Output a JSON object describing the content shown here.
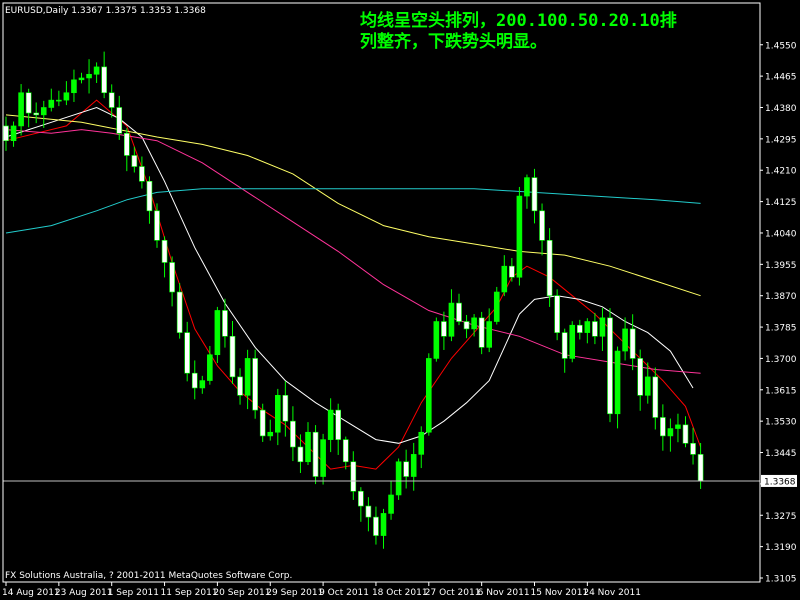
{
  "header": {
    "symbol_info": "EURUSD,Daily  1.3367 1.3375 1.3353 1.3368"
  },
  "annotation": {
    "line1": "均线呈空头排列，200.100.50.20.10排",
    "line2": "列整齐，下跌势头明显。"
  },
  "footer": {
    "copyright": "FX Solutions Australia, ? 2001-2011 MetaQuotes Software Corp."
  },
  "colors": {
    "background": "#000000",
    "frame": "#ffffff",
    "grid": "#c0c0c0",
    "bull": "#00ff00",
    "bear": "#ffffff",
    "current_price_line": "#c0c0c0",
    "annotation": "#00ff00",
    "ma10": "#ff0000",
    "ma20": "#ffffff",
    "ma50": "#ff3399",
    "ma100": "#ffff66",
    "ma200": "#22cccc"
  },
  "chart_data": {
    "type": "candlestick",
    "symbol": "EURUSD",
    "timeframe": "Daily",
    "current_price": 1.3368,
    "ylim": [
      1.3105,
      1.459
    ],
    "y_ticks": [
      1.455,
      1.4465,
      1.438,
      1.4295,
      1.421,
      1.4125,
      1.404,
      1.3955,
      1.387,
      1.3785,
      1.37,
      1.3615,
      1.353,
      1.3445,
      1.336,
      1.3275,
      1.319,
      1.3105
    ],
    "y_tick_labels": [
      "1.4550",
      "1.4465",
      "1.4380",
      "1.4295",
      "1.4210",
      "1.4125",
      "1.4040",
      "1.3955",
      "1.3870",
      "1.3785",
      "1.3700",
      "1.3615",
      "1.3530",
      "1.3445",
      "1.3368",
      "1.3275",
      "1.3190",
      "1.3105"
    ],
    "x_labels": [
      {
        "label": "14 Aug 2011",
        "bar": 0
      },
      {
        "label": "23 Aug 2011",
        "bar": 7
      },
      {
        "label": "1 Sep 2011",
        "bar": 14
      },
      {
        "label": "11 Sep 2011",
        "bar": 21
      },
      {
        "label": "20 Sep 2011",
        "bar": 28
      },
      {
        "label": "29 Sep 2011",
        "bar": 35
      },
      {
        "label": "9 Oct 2011",
        "bar": 42
      },
      {
        "label": "18 Oct 2011",
        "bar": 49
      },
      {
        "label": "27 Oct 2011",
        "bar": 56
      },
      {
        "label": "6 Nov 2011",
        "bar": 63
      },
      {
        "label": "15 Nov 2011",
        "bar": 70
      },
      {
        "label": "24 Nov 2011",
        "bar": 77
      }
    ],
    "close": [
      1.429,
      1.433,
      1.442,
      1.4365,
      1.436,
      1.438,
      1.44,
      1.44,
      1.442,
      1.4455,
      1.446,
      1.447,
      1.449,
      1.442,
      1.438,
      1.431,
      1.425,
      1.422,
      1.418,
      1.41,
      1.402,
      1.396,
      1.388,
      1.377,
      1.366,
      1.362,
      1.364,
      1.371,
      1.383,
      1.376,
      1.365,
      1.36,
      1.37,
      1.356,
      1.349,
      1.35,
      1.36,
      1.353,
      1.346,
      1.342,
      1.35,
      1.338,
      1.348,
      1.356,
      1.348,
      1.342,
      1.334,
      1.33,
      1.327,
      1.322,
      1.328,
      1.333,
      1.342,
      1.338,
      1.344,
      1.35,
      1.37,
      1.38,
      1.376,
      1.385,
      1.38,
      1.378,
      1.381,
      1.373,
      1.38,
      1.388,
      1.395,
      1.392,
      1.414,
      1.419,
      1.41,
      1.402,
      1.387,
      1.377,
      1.37,
      1.379,
      1.377,
      1.38,
      1.376,
      1.381,
      1.355,
      1.372,
      1.378,
      1.37,
      1.36,
      1.365,
      1.354,
      1.349,
      1.351,
      1.352,
      1.347,
      1.344,
      1.3368
    ],
    "series": [
      {
        "name": "MA10",
        "color": "#ff0000",
        "points": [
          [
            0,
            1.429
          ],
          [
            8,
            1.433
          ],
          [
            12,
            1.44
          ],
          [
            16,
            1.433
          ],
          [
            19,
            1.416
          ],
          [
            22,
            1.396
          ],
          [
            25,
            1.378
          ],
          [
            28,
            1.368
          ],
          [
            31,
            1.361
          ],
          [
            34,
            1.356
          ],
          [
            37,
            1.352
          ],
          [
            40,
            1.346
          ],
          [
            43,
            1.34
          ],
          [
            46,
            1.341
          ],
          [
            49,
            1.34
          ],
          [
            52,
            1.346
          ],
          [
            55,
            1.358
          ],
          [
            57,
            1.364
          ],
          [
            59,
            1.37
          ],
          [
            62,
            1.377
          ],
          [
            65,
            1.384
          ],
          [
            67,
            1.392
          ],
          [
            69,
            1.395
          ],
          [
            72,
            1.392
          ],
          [
            75,
            1.387
          ],
          [
            78,
            1.382
          ],
          [
            81,
            1.376
          ],
          [
            84,
            1.37
          ],
          [
            87,
            1.364
          ],
          [
            90,
            1.357
          ],
          [
            92,
            1.346
          ]
        ]
      },
      {
        "name": "MA20",
        "color": "#ffffff",
        "points": [
          [
            0,
            1.43
          ],
          [
            6,
            1.434
          ],
          [
            12,
            1.438
          ],
          [
            15,
            1.435
          ],
          [
            18,
            1.43
          ],
          [
            21,
            1.418
          ],
          [
            25,
            1.4
          ],
          [
            29,
            1.385
          ],
          [
            33,
            1.373
          ],
          [
            37,
            1.364
          ],
          [
            41,
            1.358
          ],
          [
            45,
            1.353
          ],
          [
            49,
            1.348
          ],
          [
            52,
            1.347
          ],
          [
            55,
            1.349
          ],
          [
            58,
            1.353
          ],
          [
            61,
            1.358
          ],
          [
            64,
            1.364
          ],
          [
            66,
            1.373
          ],
          [
            68,
            1.382
          ],
          [
            70,
            1.386
          ],
          [
            73,
            1.387
          ],
          [
            76,
            1.386
          ],
          [
            79,
            1.384
          ],
          [
            82,
            1.38
          ],
          [
            85,
            1.377
          ],
          [
            88,
            1.372
          ],
          [
            91,
            1.362
          ]
        ]
      },
      {
        "name": "MA50",
        "color": "#ff3399",
        "points": [
          [
            0,
            1.432
          ],
          [
            6,
            1.431
          ],
          [
            10,
            1.432
          ],
          [
            14,
            1.431
          ],
          [
            20,
            1.429
          ],
          [
            26,
            1.423
          ],
          [
            32,
            1.415
          ],
          [
            38,
            1.407
          ],
          [
            44,
            1.399
          ],
          [
            50,
            1.39
          ],
          [
            56,
            1.383
          ],
          [
            62,
            1.379
          ],
          [
            68,
            1.376
          ],
          [
            74,
            1.371
          ],
          [
            80,
            1.369
          ],
          [
            86,
            1.367
          ],
          [
            92,
            1.366
          ]
        ]
      },
      {
        "name": "MA100",
        "color": "#ffff66",
        "points": [
          [
            0,
            1.436
          ],
          [
            10,
            1.434
          ],
          [
            20,
            1.43
          ],
          [
            26,
            1.428
          ],
          [
            32,
            1.425
          ],
          [
            38,
            1.42
          ],
          [
            44,
            1.412
          ],
          [
            50,
            1.406
          ],
          [
            56,
            1.403
          ],
          [
            62,
            1.401
          ],
          [
            68,
            1.399
          ],
          [
            74,
            1.398
          ],
          [
            80,
            1.395
          ],
          [
            86,
            1.391
          ],
          [
            92,
            1.387
          ]
        ]
      },
      {
        "name": "MA200",
        "color": "#22cccc",
        "points": [
          [
            0,
            1.404
          ],
          [
            6,
            1.406
          ],
          [
            12,
            1.41
          ],
          [
            16,
            1.413
          ],
          [
            20,
            1.415
          ],
          [
            26,
            1.416
          ],
          [
            34,
            1.416
          ],
          [
            44,
            1.416
          ],
          [
            54,
            1.416
          ],
          [
            62,
            1.416
          ],
          [
            70,
            1.415
          ],
          [
            78,
            1.414
          ],
          [
            86,
            1.413
          ],
          [
            92,
            1.412
          ]
        ]
      }
    ],
    "grid": false,
    "legend": "none"
  }
}
